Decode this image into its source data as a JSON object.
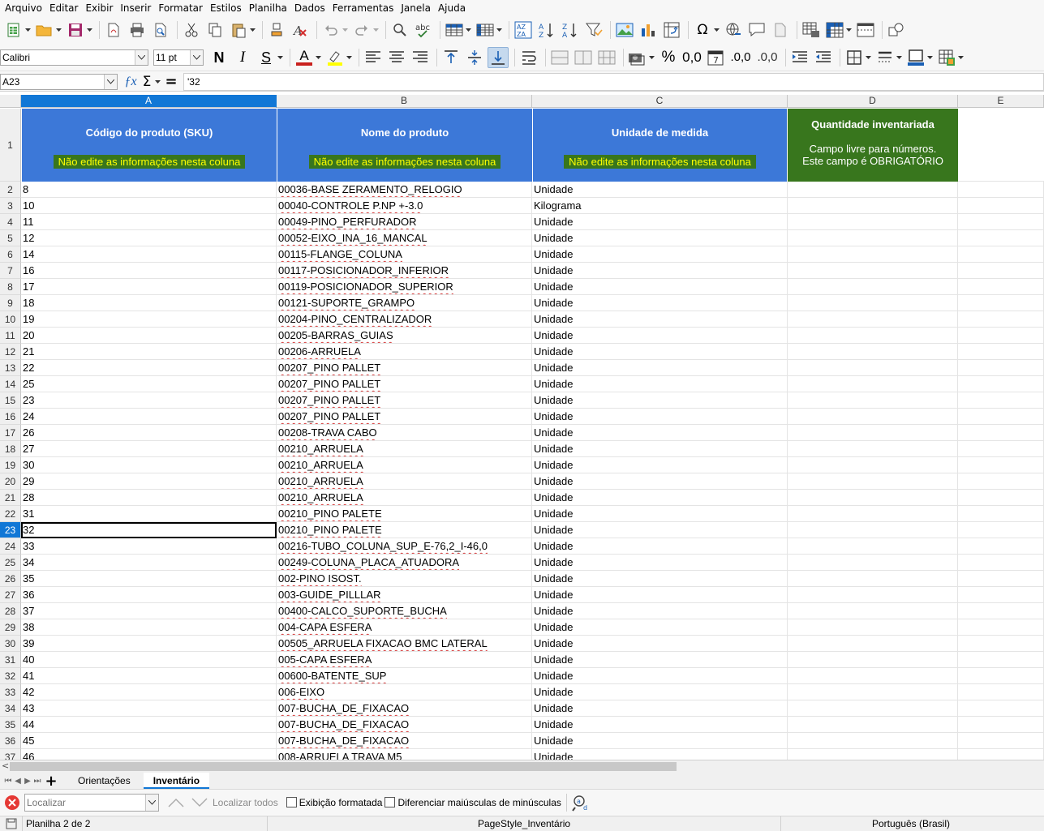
{
  "menu": [
    "Arquivo",
    "Editar",
    "Exibir",
    "Inserir",
    "Formatar",
    "Estilos",
    "Planilha",
    "Dados",
    "Ferramentas",
    "Janela",
    "Ajuda"
  ],
  "toolbar2": {
    "font_name": "Calibri",
    "font_size": "11 pt",
    "bold_label": "N",
    "italic_label": "I",
    "underline_label": "S",
    "font_color_label": "A",
    "percent_label": "%",
    "number_label": "0,0",
    "add_decimal_label": ".0,0",
    "remove_decimal_label": ".0,0"
  },
  "formula": {
    "cell_ref": "A23",
    "content": "'32"
  },
  "colors": {
    "header_blue": "#3c78d8",
    "header_green": "#38761d",
    "warning_yellow": "#ffff00",
    "selection_blue": "#1177d6"
  },
  "columns": [
    "A",
    "B",
    "C",
    "D",
    "E"
  ],
  "header_row": {
    "sku_title": "Código do produto (SKU)",
    "name_title": "Nome do produto",
    "unit_title": "Unidade de medida",
    "warning": "Não edite as informações nesta coluna",
    "qty_title": "Quantidade inventariada",
    "qty_line1": "Campo livre para números.",
    "qty_line2": "Este campo é OBRIGATÓRIO"
  },
  "rows": [
    {
      "n": "2",
      "sku": "8",
      "name": "00036-BASE ZERAMENTO_RELOGIO",
      "unit": "Unidade"
    },
    {
      "n": "3",
      "sku": "10",
      "name": "00040-CONTROLE P.NP +-3.0",
      "unit": "Kilograma"
    },
    {
      "n": "4",
      "sku": "11",
      "name": "00049-PINO_PERFURADOR",
      "unit": "Unidade"
    },
    {
      "n": "5",
      "sku": "12",
      "name": "00052-EIXO_INA_16_MANCAL",
      "unit": "Unidade"
    },
    {
      "n": "6",
      "sku": "14",
      "name": "00115-FLANGE_COLUNA",
      "unit": "Unidade"
    },
    {
      "n": "7",
      "sku": "16",
      "name": "00117-POSICIONADOR_INFERIOR",
      "unit": "Unidade"
    },
    {
      "n": "8",
      "sku": "17",
      "name": "00119-POSICIONADOR_SUPERIOR",
      "unit": "Unidade"
    },
    {
      "n": "9",
      "sku": "18",
      "name": "00121-SUPORTE_GRAMPO",
      "unit": "Unidade"
    },
    {
      "n": "10",
      "sku": "19",
      "name": "00204-PINO_CENTRALIZADOR",
      "unit": "Unidade"
    },
    {
      "n": "11",
      "sku": "20",
      "name": "00205-BARRAS_GUIAS",
      "unit": "Unidade"
    },
    {
      "n": "12",
      "sku": "21",
      "name": "00206-ARRUELA",
      "unit": "Unidade"
    },
    {
      "n": "13",
      "sku": "22",
      "name": "00207_PINO PALLET",
      "unit": "Unidade"
    },
    {
      "n": "14",
      "sku": "25",
      "name": "00207_PINO PALLET",
      "unit": "Unidade"
    },
    {
      "n": "15",
      "sku": "23",
      "name": "00207_PINO PALLET",
      "unit": "Unidade"
    },
    {
      "n": "16",
      "sku": "24",
      "name": "00207_PINO PALLET",
      "unit": "Unidade"
    },
    {
      "n": "17",
      "sku": "26",
      "name": "00208-TRAVA CABO",
      "unit": "Unidade"
    },
    {
      "n": "18",
      "sku": "27",
      "name": "00210_ARRUELA",
      "unit": "Unidade"
    },
    {
      "n": "19",
      "sku": "30",
      "name": "00210_ARRUELA",
      "unit": "Unidade"
    },
    {
      "n": "20",
      "sku": "29",
      "name": "00210_ARRUELA",
      "unit": "Unidade"
    },
    {
      "n": "21",
      "sku": "28",
      "name": "00210_ARRUELA",
      "unit": "Unidade"
    },
    {
      "n": "22",
      "sku": "31",
      "name": "00210_PINO PALETE",
      "unit": "Unidade"
    },
    {
      "n": "23",
      "sku": "32",
      "name": "00210_PINO PALETE",
      "unit": "Unidade"
    },
    {
      "n": "24",
      "sku": "33",
      "name": "00216-TUBO_COLUNA_SUP_E-76,2_I-46,0",
      "unit": "Unidade"
    },
    {
      "n": "25",
      "sku": "34",
      "name": "00249-COLUNA_PLACA_ATUADORA",
      "unit": "Unidade"
    },
    {
      "n": "26",
      "sku": "35",
      "name": "002-PINO ISOST.",
      "unit": "Unidade"
    },
    {
      "n": "27",
      "sku": "36",
      "name": "003-GUIDE_PILLLAR",
      "unit": "Unidade"
    },
    {
      "n": "28",
      "sku": "37",
      "name": "00400-CALCO_SUPORTE_BUCHA",
      "unit": "Unidade"
    },
    {
      "n": "29",
      "sku": "38",
      "name": "004-CAPA ESFERA",
      "unit": "Unidade"
    },
    {
      "n": "30",
      "sku": "39",
      "name": "00505_ARRUELA FIXACAO BMC LATERAL",
      "unit": "Unidade"
    },
    {
      "n": "31",
      "sku": "40",
      "name": "005-CAPA ESFERA",
      "unit": "Unidade"
    },
    {
      "n": "32",
      "sku": "41",
      "name": "00600-BATENTE_SUP",
      "unit": "Unidade"
    },
    {
      "n": "33",
      "sku": "42",
      "name": "006-EIXO",
      "unit": "Unidade"
    },
    {
      "n": "34",
      "sku": "43",
      "name": "007-BUCHA_DE_FIXACAO",
      "unit": "Unidade"
    },
    {
      "n": "35",
      "sku": "44",
      "name": "007-BUCHA_DE_FIXACAO",
      "unit": "Unidade"
    },
    {
      "n": "36",
      "sku": "45",
      "name": "007-BUCHA_DE_FIXACAO",
      "unit": "Unidade"
    },
    {
      "n": "37",
      "sku": "46",
      "name": "008-ARRUELA TRAVA M5",
      "unit": "Unidade"
    }
  ],
  "sheet_tabs": {
    "tab1": "Orientações",
    "tab2": "Inventário"
  },
  "find": {
    "placeholder": "Localizar",
    "find_all": "Localizar todos",
    "formatted_display": "Exibição formatada",
    "match_case": "Diferenciar maiúsculas de minúsculas"
  },
  "status": {
    "sheet_info": "Planilha 2 de 2",
    "page_style": "PageStyle_Inventário",
    "language": "Português (Brasil)"
  }
}
